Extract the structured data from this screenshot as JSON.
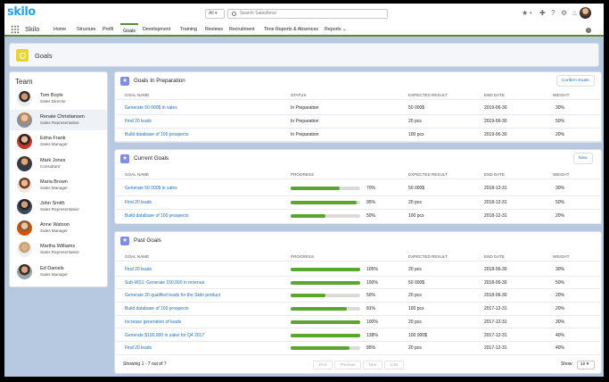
{
  "app": {
    "logo": "skilo",
    "name": "Skilo",
    "scope": "All",
    "search_placeholder": "Search Salesforce"
  },
  "nav": [
    {
      "label": "Home"
    },
    {
      "label": "Structure"
    },
    {
      "label": "Profil"
    },
    {
      "label": "Goals",
      "active": true
    },
    {
      "label": "Development"
    },
    {
      "label": "Training"
    },
    {
      "label": "Reviews"
    },
    {
      "label": "Recruitment"
    },
    {
      "label": "Time Reports & Absences"
    },
    {
      "label": "Reports"
    }
  ],
  "page_title": "Goals",
  "team": {
    "title": "Team",
    "members": [
      {
        "name": "Tom Boyle",
        "role": "Sales Director",
        "skin": "#c99a7a",
        "hair": "#3a2a20",
        "shirt": "#e9ecef"
      },
      {
        "name": "Renate Christiansen",
        "role": "Sales Representative",
        "skin": "#e8c3a5",
        "hair": "#b98a5c",
        "shirt": "#8a8f98",
        "selected": true
      },
      {
        "name": "Edna Frank",
        "role": "Sales Manager",
        "skin": "#e3b898",
        "hair": "#2c201a",
        "shirt": "#c0392b"
      },
      {
        "name": "Mark Jones",
        "role": "Consultant",
        "skin": "#d7a886",
        "hair": "#4b3527",
        "shirt": "#2c3e50"
      },
      {
        "name": "Maria Brown",
        "role": "Sales Manager",
        "skin": "#e6b99a",
        "hair": "#6d3d22",
        "shirt": "#f0e6dc"
      },
      {
        "name": "John Smith",
        "role": "Sales Representative",
        "skin": "#caa084",
        "hair": "#2a211c",
        "shirt": "#34495e"
      },
      {
        "name": "Anne Watson",
        "role": "Sales Manager",
        "skin": "#eac4a6",
        "hair": "#8a5a3a",
        "shirt": "#d35400"
      },
      {
        "name": "Martha Williams",
        "role": "Sales Representative",
        "skin": "#ddb090",
        "hair": "#c9a36b",
        "shirt": "#ecf0f1"
      },
      {
        "name": "Ed Daniels",
        "role": "Sales Manager",
        "skin": "#d2a384",
        "hair": "#3b2c23",
        "shirt": "#95a5a6"
      }
    ]
  },
  "in_preparation": {
    "title": "Goals In Preparation",
    "button": "Confirm Goals",
    "headers": [
      "Goal Name",
      "Status",
      "Expected Result",
      "End Date",
      "Weight"
    ],
    "rows": [
      {
        "name": "Generate 50 000$ in sales",
        "status": "In Preparation",
        "expected": "50 000$",
        "end": "2019-06-30",
        "weight": "30%"
      },
      {
        "name": "Find 20 leads",
        "status": "In Preparation",
        "expected": "20 pcs",
        "end": "2019-06-30",
        "weight": "50%"
      },
      {
        "name": "Build database of 100 prospects",
        "status": "In Preparation",
        "expected": "100 pcs",
        "end": "2019-06-30",
        "weight": "20%"
      }
    ]
  },
  "current": {
    "title": "Current Goals",
    "button": "New",
    "headers": [
      "Goal Name",
      "Progress",
      "Expected Result",
      "End Date",
      "Weight"
    ],
    "rows": [
      {
        "name": "Generate 50 000$ in sales",
        "progress": 70,
        "progress_label": "70%",
        "expected": "50 000$",
        "end": "2018-12-31",
        "weight": "30%"
      },
      {
        "name": "Find 20 leads",
        "progress": 95,
        "progress_label": "95%",
        "expected": "20 pcs",
        "end": "2018-12-31",
        "weight": "50%"
      },
      {
        "name": "Build database of 100 prospects",
        "progress": 50,
        "progress_label": "50%",
        "expected": "100 pcs",
        "end": "2018-12-31",
        "weight": "20%"
      }
    ]
  },
  "past": {
    "title": "Past Goals",
    "headers": [
      "Goal Name",
      "Progress",
      "Expected Result",
      "End Date",
      "Weight"
    ],
    "rows": [
      {
        "name": "Find 20 leads",
        "progress": 100,
        "progress_label": "105%",
        "expected": "20 pcs",
        "end": "2018-06-30",
        "weight": "30%"
      },
      {
        "name": "Sub-WS1: Generate 150,000 in revenue",
        "progress": 100,
        "progress_label": "100%",
        "expected": "50 000$",
        "end": "2018-06-30",
        "weight": "50%"
      },
      {
        "name": "Generate 20 qualified leads for the Skilo product",
        "progress": 50,
        "progress_label": "50%",
        "expected": "20 pcs",
        "end": "2018-06-30",
        "weight": "20%"
      },
      {
        "name": "Build database of 100 prospects",
        "progress": 81,
        "progress_label": "81%",
        "expected": "100 pcs",
        "end": "2017-12-31",
        "weight": "20%"
      },
      {
        "name": "Increase generation of leads",
        "progress": 100,
        "progress_label": "100%",
        "expected": "20 pcs",
        "end": "2017-12-31",
        "weight": "30%"
      },
      {
        "name": "Generate $100,000 in sales for Q4 2017",
        "progress": 100,
        "progress_label": "138%",
        "expected": "100 000$",
        "end": "2017-12-31",
        "weight": "40%"
      },
      {
        "name": "Find 20 leads",
        "progress": 85,
        "progress_label": "85%",
        "expected": "20 pcs",
        "end": "2017-12-31",
        "weight": "40%"
      }
    ],
    "showing": "Showing 1 - 7 out of 7",
    "pager": [
      "First",
      "Previous",
      "Next",
      "Last"
    ],
    "show_label": "Show",
    "show_value": "10"
  },
  "colors": {
    "brand": "#2aa3d6",
    "accent_green": "#5aa62f",
    "goals_yellow": "#e8d33a",
    "card_icon": "#7f8de1",
    "link": "#1d6fb8"
  }
}
